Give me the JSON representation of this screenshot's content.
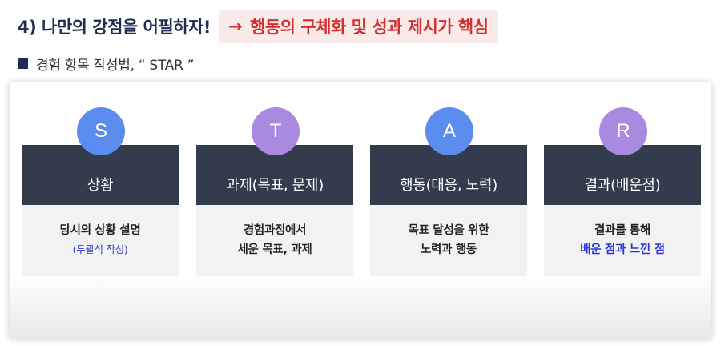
{
  "header": {
    "title": "4) 나만의 강점을 어필하자!",
    "highlight_arrow": "→",
    "highlight_text": "행동의 구체화 및 성과 제시가 핵심"
  },
  "subtitle": "경험 항목 작성법, “ STAR ”",
  "colors": {
    "title": "#1f2d4e",
    "highlight_text": "#d32f2f",
    "highlight_bg": "#fbeaea",
    "card_head": "#333c4d",
    "card_body": "#f2f2f2",
    "circle_blue": "#5b8def",
    "circle_purple": "#a98ae0",
    "accent_blue": "#2b35d6"
  },
  "cards": [
    {
      "letter": "S",
      "heading": "상황",
      "body_line1": "당시의 상황 설명",
      "body_line2": "(두괄식 작성)"
    },
    {
      "letter": "T",
      "heading": "과제(목표, 문제)",
      "body_line1": "경험과정에서",
      "body_line2": "세운 목표, 과제"
    },
    {
      "letter": "A",
      "heading": "행동(대응, 노력)",
      "body_line1": "목표 달성을 위한",
      "body_line2": "노력과 행동"
    },
    {
      "letter": "R",
      "heading": "결과(배운점)",
      "body_line1": "결과를 통해",
      "body_line2": "배운 점과 느낀 점"
    }
  ]
}
